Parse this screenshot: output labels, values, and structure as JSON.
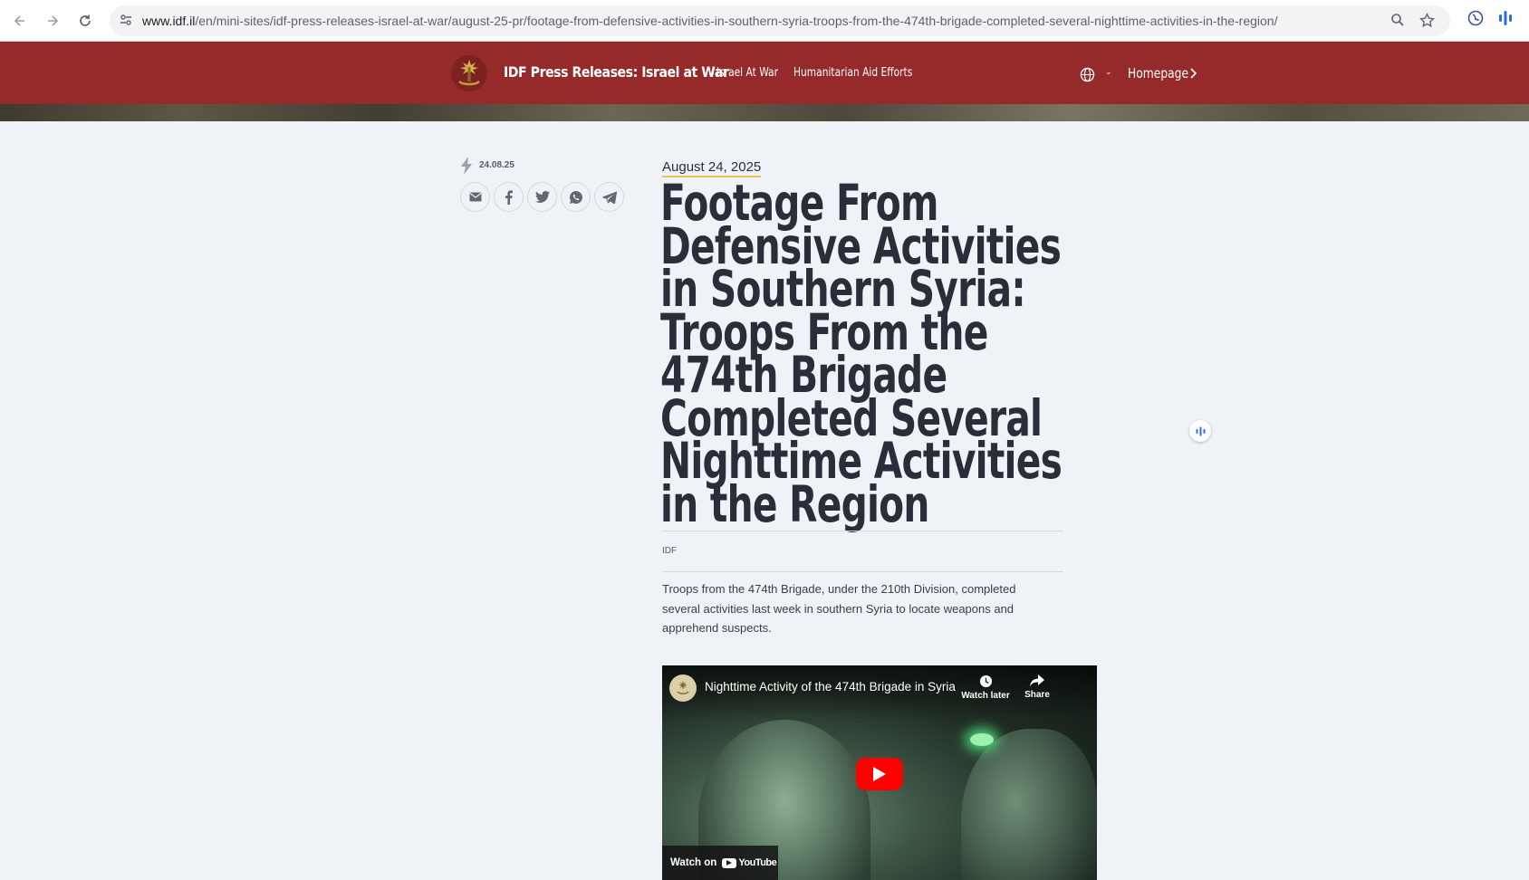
{
  "browser": {
    "url_host": "www.idf.il",
    "url_path": "/en/mini-sites/idf-press-releases-israel-at-war/august-25-pr/footage-from-defensive-activities-in-southern-syria-troops-from-the-474th-brigade-completed-several-nighttime-activities-in-the-region/",
    "icons": [
      "back-icon",
      "forward-icon",
      "reload-icon",
      "site-settings-icon",
      "zoom-icon",
      "bookmark-star-icon",
      "extension-icon",
      "audio-reader-icon"
    ]
  },
  "header": {
    "site_title": "IDF Press Releases: Israel at War",
    "nav": [
      "Israel At War",
      "Humanitarian Aid Efforts"
    ],
    "homepage_label": "Homepage",
    "bg_color": "#962a2a"
  },
  "meta": {
    "short_date": "24.08.25",
    "share_icons": [
      "email-icon",
      "facebook-icon",
      "twitter-icon",
      "whatsapp-icon",
      "telegram-icon"
    ]
  },
  "article": {
    "date": "August 24, 2025",
    "title_lines": [
      "Footage From",
      "Defensive Activities",
      "in Southern Syria:",
      "Troops From the",
      "474th Brigade",
      "Completed Several",
      "Nighttime Activities",
      "in the Region"
    ],
    "author": "IDF",
    "lead": "Troops from the 474th Brigade, under the 210th Division, completed several activities last week in southern Syria to locate weapons and apprehend suspects."
  },
  "video": {
    "title": "Nighttime Activity of the 474th Brigade in Syria",
    "watch_later": "Watch later",
    "share": "Share",
    "watch_on": "Watch on",
    "youtube": "YouTube"
  }
}
